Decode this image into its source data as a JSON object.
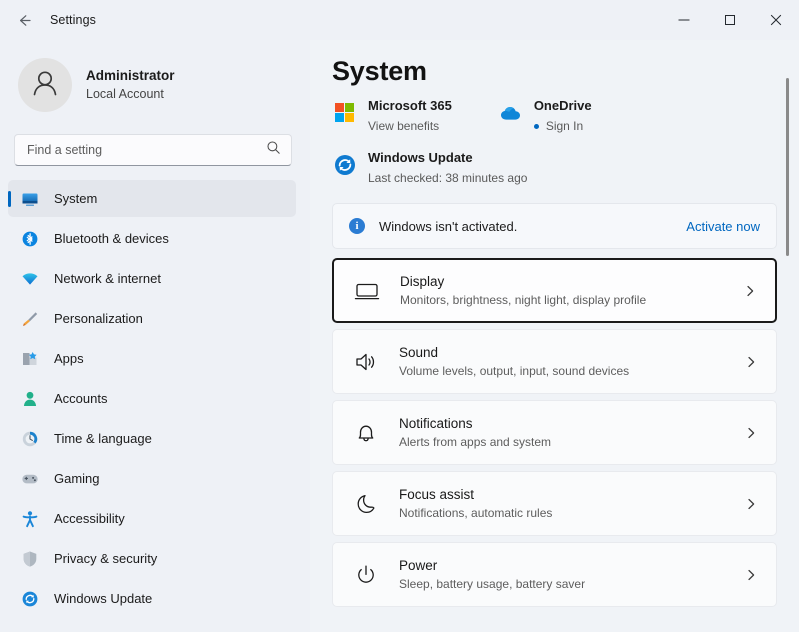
{
  "titlebar": {
    "back_label": "back-arrow",
    "app_title": "Settings",
    "minimize": "minimize",
    "maximize": "maximize",
    "close": "close"
  },
  "sidebar": {
    "account": {
      "name": "Administrator",
      "subtitle": "Local Account"
    },
    "search": {
      "placeholder": "Find a setting",
      "value": ""
    },
    "items": [
      {
        "label": "System",
        "icon": "monitor-icon",
        "active": true
      },
      {
        "label": "Bluetooth & devices",
        "icon": "bluetooth-icon",
        "active": false
      },
      {
        "label": "Network & internet",
        "icon": "wifi-icon",
        "active": false
      },
      {
        "label": "Personalization",
        "icon": "brush-icon",
        "active": false
      },
      {
        "label": "Apps",
        "icon": "apps-icon",
        "active": false
      },
      {
        "label": "Accounts",
        "icon": "person-icon",
        "active": false
      },
      {
        "label": "Time & language",
        "icon": "clock-icon",
        "active": false
      },
      {
        "label": "Gaming",
        "icon": "gamepad-icon",
        "active": false
      },
      {
        "label": "Accessibility",
        "icon": "accessibility-icon",
        "active": false
      },
      {
        "label": "Privacy & security",
        "icon": "shield-icon",
        "active": false
      },
      {
        "label": "Windows Update",
        "icon": "update-icon",
        "active": false
      }
    ]
  },
  "main": {
    "page_title": "System",
    "promos": {
      "microsoft365": {
        "title": "Microsoft 365",
        "subtitle": "View benefits",
        "icon": "microsoft-logo-icon"
      },
      "onedrive": {
        "title": "OneDrive",
        "subtitle": "Sign In",
        "icon": "onedrive-cloud-icon"
      },
      "windows_update": {
        "title": "Windows Update",
        "subtitle": "Last checked: 38 minutes ago",
        "icon": "update-refresh-icon"
      }
    },
    "banner": {
      "icon": "info-icon",
      "text": "Windows isn't activated.",
      "link_label": "Activate now"
    },
    "cards": [
      {
        "title": "Display",
        "subtitle": "Monitors, brightness, night light, display profile",
        "icon": "monitor-icon",
        "focused": true
      },
      {
        "title": "Sound",
        "subtitle": "Volume levels, output, input, sound devices",
        "icon": "speaker-icon",
        "focused": false
      },
      {
        "title": "Notifications",
        "subtitle": "Alerts from apps and system",
        "icon": "bell-icon",
        "focused": false
      },
      {
        "title": "Focus assist",
        "subtitle": "Notifications, automatic rules",
        "icon": "moon-icon",
        "focused": false
      },
      {
        "title": "Power",
        "subtitle": "Sleep, battery usage, battery saver",
        "icon": "power-icon",
        "focused": false
      }
    ]
  },
  "colors": {
    "accent": "#0067c0",
    "window_bg": "#f0f3f7",
    "sidebar_bg": "#eef1f6",
    "card_bg": "#fafbfc",
    "focus_border": "#1a1a1a"
  }
}
